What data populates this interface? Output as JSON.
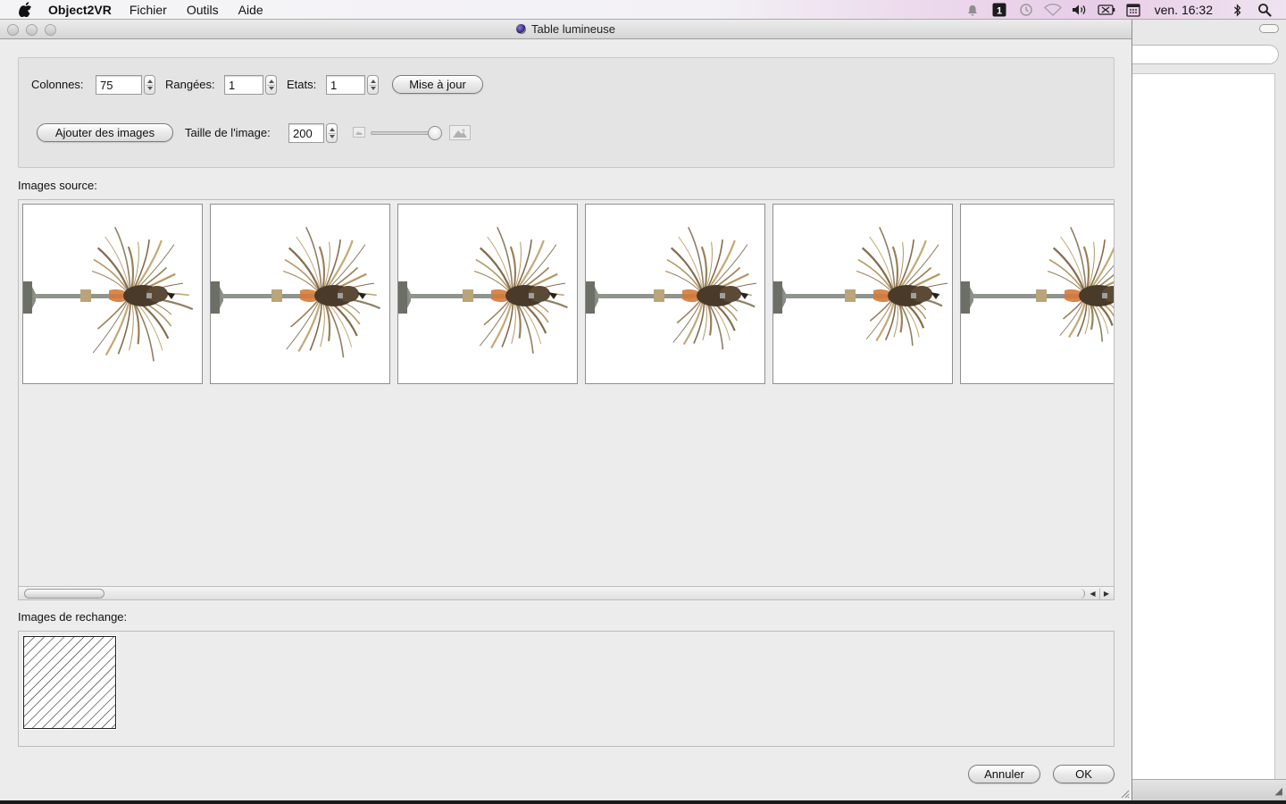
{
  "menubar": {
    "app_name": "Object2VR",
    "menus": [
      "Fichier",
      "Outils",
      "Aide"
    ],
    "clock": "ven. 16:32",
    "status_icons": [
      "bell-icon",
      "input-method-icon",
      "time-machine-icon",
      "wifi-icon",
      "volume-icon",
      "battery-icon",
      "calendar-icon",
      "bluetooth-icon",
      "spotlight-icon"
    ]
  },
  "window": {
    "title": "Table lumineuse"
  },
  "controls": {
    "columns_label": "Colonnes:",
    "columns_value": "75",
    "rows_label": "Rangées:",
    "rows_value": "1",
    "states_label": "Etats:",
    "states_value": "1",
    "update_button": "Mise à jour",
    "add_images_button": "Ajouter des images",
    "image_size_label": "Taille de l'image:",
    "image_size_value": "200",
    "size_slider_level": 0.9
  },
  "source": {
    "label": "Images source:",
    "thumbnails": [
      "frame-1",
      "frame-2",
      "frame-3",
      "frame-4",
      "frame-5",
      "frame-6"
    ]
  },
  "spare": {
    "label": "Images de rechange:"
  },
  "footer": {
    "cancel_button": "Annuler",
    "ok_button": "OK"
  }
}
